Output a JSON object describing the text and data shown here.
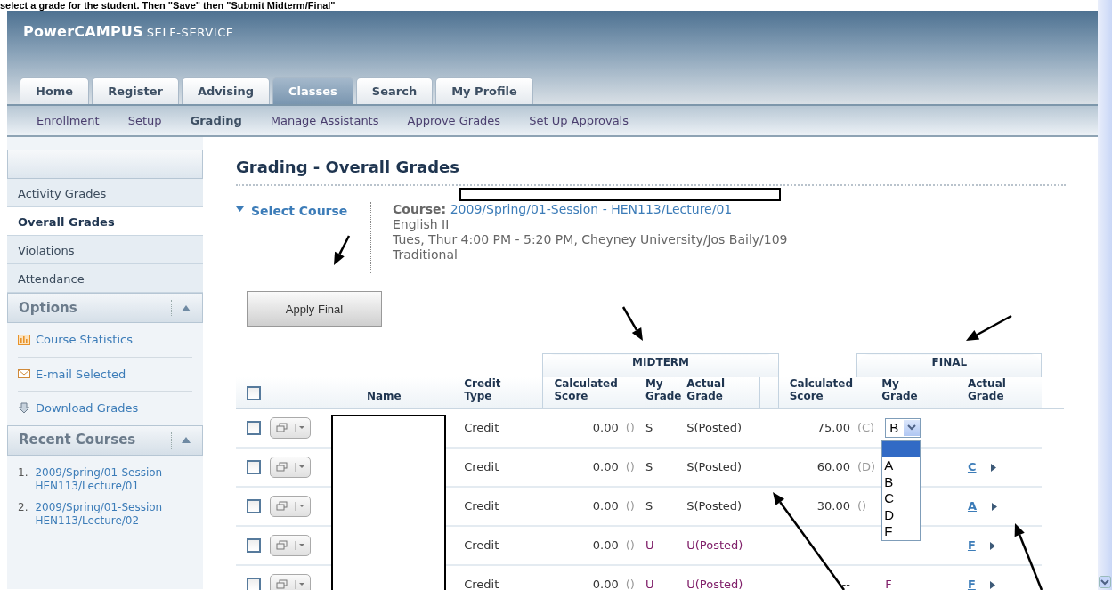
{
  "caption": "select a grade for the student. Then \"Save\" then \"Submit Midterm/Final\"",
  "app": {
    "logo": "PowerCAMPUS",
    "logo_suffix": "SELF-SERVICE"
  },
  "tabs": [
    {
      "label": "Home",
      "selected": false
    },
    {
      "label": "Register",
      "selected": false
    },
    {
      "label": "Advising",
      "selected": false
    },
    {
      "label": "Classes",
      "selected": true
    },
    {
      "label": "Search",
      "selected": false
    },
    {
      "label": "My Profile",
      "selected": false
    }
  ],
  "subnav": [
    {
      "label": "Enrollment",
      "selected": false
    },
    {
      "label": "Setup",
      "selected": false
    },
    {
      "label": "Grading",
      "selected": true
    },
    {
      "label": "Manage Assistants",
      "selected": false
    },
    {
      "label": "Approve Grades",
      "selected": false
    },
    {
      "label": "Set Up Approvals",
      "selected": false
    }
  ],
  "sidebar": {
    "items": [
      {
        "label": "Activity Grades",
        "selected": false
      },
      {
        "label": "Overall Grades",
        "selected": true
      },
      {
        "label": "Violations",
        "selected": false
      },
      {
        "label": "Attendance",
        "selected": false
      }
    ],
    "options": {
      "title": "Options",
      "expanded": true,
      "items": [
        {
          "label": "Course Statistics",
          "kind": "stats"
        },
        {
          "label": "E-mail Selected",
          "kind": "email"
        },
        {
          "label": "Download Grades",
          "kind": "download"
        }
      ]
    },
    "recent": {
      "title": "Recent Courses",
      "expanded": true,
      "items": [
        {
          "number": "1.",
          "label": "2009/Spring/01-Session HEN113/Lecture/01"
        },
        {
          "number": "2.",
          "label": "2009/Spring/01-Session HEN113/Lecture/02"
        }
      ]
    }
  },
  "page_title": "Grading - Overall Grades",
  "select_course": {
    "label": "Select Course",
    "expanded": true
  },
  "course": {
    "label": "Course:",
    "link": "2009/Spring/01-Session - HEN113/Lecture/01",
    "lines": [
      "English II",
      "Tues, Thur 4:00 PM - 5:20 PM, Cheyney University/Jos Baily/109",
      "Traditional"
    ]
  },
  "apply_button": "Apply Final",
  "table": {
    "all_checked": false,
    "groups": [
      "MIDTERM",
      "FINAL"
    ],
    "columns": [
      "Name",
      "Credit Type",
      "Calculated Score",
      "My Grade",
      "Actual Grade",
      "Calculated Score",
      "My Grade",
      "Actual Grade"
    ],
    "rows": [
      {
        "checked": false,
        "flagged": false,
        "credit_type": "Credit",
        "mid_score": "0.00",
        "mid_letter": "()",
        "mid_grade": "S",
        "mid_actual": "S(Posted)",
        "final_score": "75.00",
        "final_letter": "(C)",
        "final_grade": {
          "kind": "select",
          "value": "B"
        }
      },
      {
        "checked": false,
        "flagged": false,
        "credit_type": "Credit",
        "mid_score": "0.00",
        "mid_letter": "()",
        "mid_grade": "S",
        "mid_actual": "S(Posted)",
        "final_score": "60.00",
        "final_letter": "(D)",
        "final_actual": "C"
      },
      {
        "checked": false,
        "flagged": false,
        "credit_type": "Credit",
        "mid_score": "0.00",
        "mid_letter": "()",
        "mid_grade": "S",
        "mid_actual": "S(Posted)",
        "final_score": "30.00",
        "final_letter": "()",
        "final_actual": "A"
      },
      {
        "checked": false,
        "flagged": true,
        "credit_type": "Credit",
        "mid_score": "0.00",
        "mid_letter": "()",
        "mid_grade": "U",
        "mid_actual": "U(Posted)",
        "final_score": "--",
        "final_actual": "F"
      },
      {
        "checked": false,
        "flagged": true,
        "credit_type": "Credit",
        "mid_score": "0.00",
        "mid_letter": "()",
        "mid_grade": "U",
        "mid_actual": "U(Posted)",
        "final_score": "--",
        "final_grade": {
          "kind": "text",
          "value": "F"
        },
        "final_actual": "F"
      }
    ]
  },
  "grade_dropdown": {
    "blank_selected": true,
    "options": [
      {
        "label": "A",
        "selected": false
      },
      {
        "label": "B",
        "selected": false
      },
      {
        "label": "C",
        "selected": false
      },
      {
        "label": "D",
        "selected": false
      },
      {
        "label": "F",
        "selected": false
      }
    ]
  }
}
